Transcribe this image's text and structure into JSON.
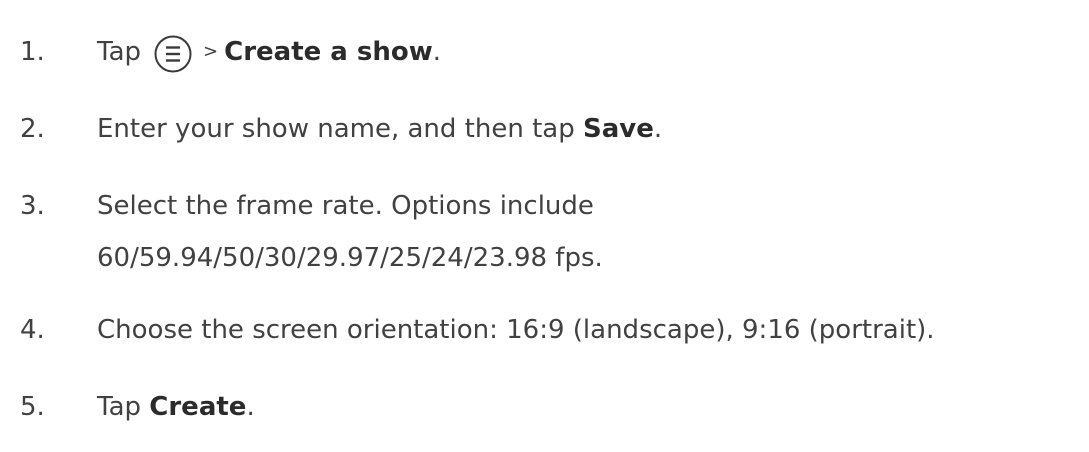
{
  "steps": [
    {
      "number": "1.",
      "before": "Tap",
      "icon": "menu-circle-icon",
      "separator": ">",
      "bold": "Create a show",
      "after": "."
    },
    {
      "number": "2.",
      "before": "Enter your show name, and then tap",
      "bold": "Save",
      "after": "."
    },
    {
      "number": "3.",
      "line1": "Select the frame rate. Options include",
      "line2": "60/59.94/50/30/29.97/25/24/23.98 fps."
    },
    {
      "number": "4.",
      "text": "Choose the screen orientation: 16:9 (landscape), 9:16 (portrait)."
    },
    {
      "number": "5.",
      "before": "Tap",
      "bold": "Create",
      "after": "."
    }
  ],
  "colors": {
    "text": "#414141",
    "bold_text": "#2b2b2b",
    "icon_stroke": "#3a3a3a"
  }
}
